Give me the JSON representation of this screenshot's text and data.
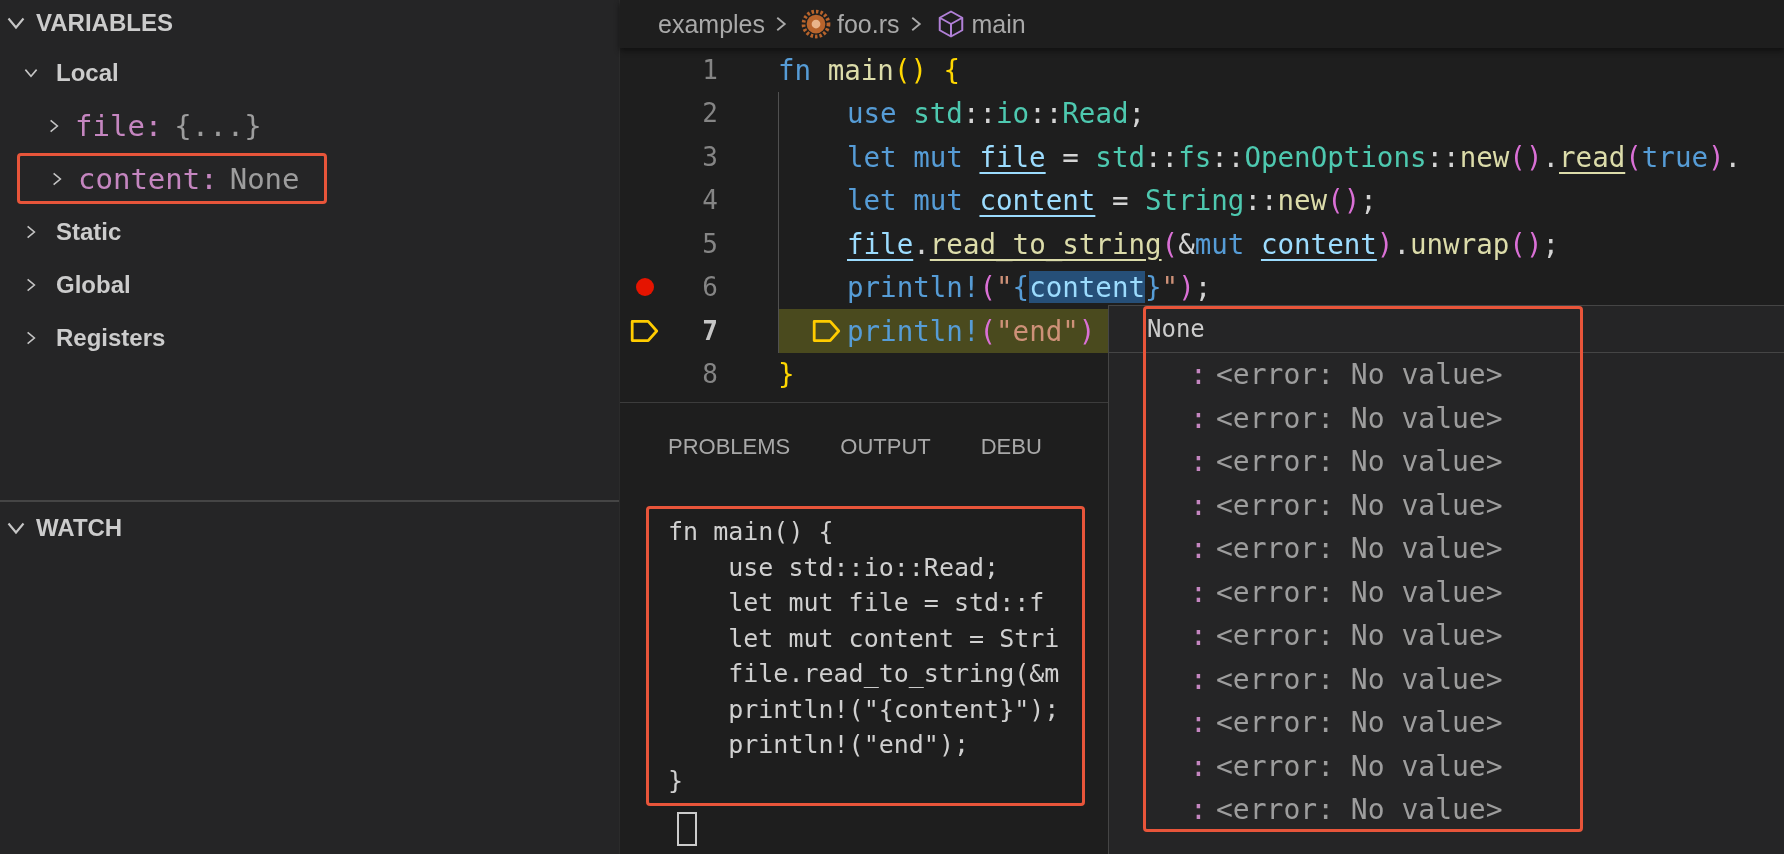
{
  "variables": {
    "title": "VARIABLES",
    "expanded": true,
    "scopes": [
      {
        "label": "Local",
        "expanded": true,
        "children": [
          {
            "name": "file:",
            "value": "{...}",
            "expanded": false,
            "highlighted": false
          },
          {
            "name": "content:",
            "value": "None",
            "expanded": false,
            "highlighted": true
          }
        ]
      },
      {
        "label": "Static",
        "expanded": false
      },
      {
        "label": "Global",
        "expanded": false
      },
      {
        "label": "Registers",
        "expanded": false
      }
    ]
  },
  "watch": {
    "title": "WATCH",
    "expanded": true
  },
  "breadcrumb": [
    {
      "label": "examples",
      "kind": "folder"
    },
    {
      "label": "foo.rs",
      "kind": "file"
    },
    {
      "label": "main",
      "kind": "symbol"
    }
  ],
  "code": [
    {
      "number": "1",
      "indented": false,
      "breakpoint": false,
      "current": false,
      "tokens": [
        {
          "text": "fn ",
          "kind": "keyword"
        },
        {
          "text": "main",
          "kind": "function"
        },
        {
          "text": "() {",
          "kind": "bracket1"
        }
      ]
    },
    {
      "number": "2",
      "indented": true,
      "breakpoint": false,
      "current": false,
      "tokens": [
        {
          "text": "use ",
          "kind": "keyword"
        },
        {
          "text": "std",
          "kind": "type"
        },
        {
          "text": "::",
          "kind": "punct"
        },
        {
          "text": "io",
          "kind": "type"
        },
        {
          "text": "::",
          "kind": "punct"
        },
        {
          "text": "Read",
          "kind": "type"
        },
        {
          "text": ";",
          "kind": "punct"
        }
      ]
    },
    {
      "number": "3",
      "indented": true,
      "breakpoint": false,
      "current": false,
      "tokens": [
        {
          "text": "let mut ",
          "kind": "keyword"
        },
        {
          "text": "file",
          "kind": "mutable"
        },
        {
          "text": " = ",
          "kind": "punct"
        },
        {
          "text": "std",
          "kind": "type"
        },
        {
          "text": "::",
          "kind": "punct"
        },
        {
          "text": "fs",
          "kind": "type"
        },
        {
          "text": "::",
          "kind": "punct"
        },
        {
          "text": "OpenOptions",
          "kind": "type"
        },
        {
          "text": "::",
          "kind": "punct"
        },
        {
          "text": "new",
          "kind": "function"
        },
        {
          "text": "()",
          "kind": "bracket2"
        },
        {
          "text": ".",
          "kind": "punct"
        },
        {
          "text": "read",
          "kind": "function-mut"
        },
        {
          "text": "(",
          "kind": "bracket2"
        },
        {
          "text": "true",
          "kind": "keyword"
        },
        {
          "text": ")",
          "kind": "bracket2"
        },
        {
          "text": ".",
          "kind": "punct"
        }
      ]
    },
    {
      "number": "4",
      "indented": true,
      "breakpoint": false,
      "current": false,
      "tokens": [
        {
          "text": "let mut ",
          "kind": "keyword"
        },
        {
          "text": "content",
          "kind": "mutable"
        },
        {
          "text": " = ",
          "kind": "punct"
        },
        {
          "text": "String",
          "kind": "type"
        },
        {
          "text": "::",
          "kind": "punct"
        },
        {
          "text": "new",
          "kind": "function"
        },
        {
          "text": "()",
          "kind": "bracket2"
        },
        {
          "text": ";",
          "kind": "punct"
        }
      ]
    },
    {
      "number": "5",
      "indented": true,
      "breakpoint": false,
      "current": false,
      "tokens": [
        {
          "text": "file",
          "kind": "mutable"
        },
        {
          "text": ".",
          "kind": "punct"
        },
        {
          "text": "read_to_string",
          "kind": "function-mut"
        },
        {
          "text": "(",
          "kind": "bracket2"
        },
        {
          "text": "&",
          "kind": "punct"
        },
        {
          "text": "mut ",
          "kind": "keyword"
        },
        {
          "text": "content",
          "kind": "mutable"
        },
        {
          "text": ")",
          "kind": "bracket2"
        },
        {
          "text": ".",
          "kind": "punct"
        },
        {
          "text": "unwrap",
          "kind": "function"
        },
        {
          "text": "()",
          "kind": "bracket2"
        },
        {
          "text": ";",
          "kind": "punct"
        }
      ]
    },
    {
      "number": "6",
      "indented": true,
      "breakpoint": true,
      "current": false,
      "tokens": [
        {
          "text": "println!",
          "kind": "macro"
        },
        {
          "text": "(",
          "kind": "bracket2"
        },
        {
          "text": "\"",
          "kind": "string"
        },
        {
          "text": "{",
          "kind": "interp-brace"
        },
        {
          "text": "content",
          "kind": "interp-hover"
        },
        {
          "text": "}",
          "kind": "interp-brace"
        },
        {
          "text": "\"",
          "kind": "string"
        },
        {
          "text": ")",
          "kind": "bracket2"
        },
        {
          "text": ";",
          "kind": "punct"
        }
      ]
    },
    {
      "number": "7",
      "indented": true,
      "breakpoint": false,
      "current": true,
      "tokens": [
        {
          "text": "println!",
          "kind": "macro"
        },
        {
          "text": "(",
          "kind": "bracket2"
        },
        {
          "text": "\"end\"",
          "kind": "string"
        },
        {
          "text": ")",
          "kind": "bracket2"
        }
      ]
    },
    {
      "number": "8",
      "indented": false,
      "breakpoint": false,
      "current": false,
      "tokens": [
        {
          "text": "}",
          "kind": "bracket1"
        }
      ]
    }
  ],
  "panel_tabs": [
    {
      "label": "PROBLEMS"
    },
    {
      "label": "OUTPUT"
    },
    {
      "label": "DEBU"
    }
  ],
  "terminal": {
    "highlighted": true,
    "cursor": true,
    "lines": [
      "fn main() {",
      "    use std::io::Read;",
      "    let mut file = std::f",
      "    let mut content = Stri",
      "    file.read_to_string(&m",
      "    println!(\"{content}\");",
      "    println!(\"end\");",
      "}"
    ]
  },
  "hover": {
    "title": "None",
    "highlighted": true,
    "rows": [
      {
        "key": ":",
        "value": "<error: No value>"
      },
      {
        "key": ":",
        "value": "<error: No value>"
      },
      {
        "key": ":",
        "value": "<error: No value>"
      },
      {
        "key": ":",
        "value": "<error: No value>"
      },
      {
        "key": ":",
        "value": "<error: No value>"
      },
      {
        "key": ":",
        "value": "<error: No value>"
      },
      {
        "key": ":",
        "value": "<error: No value>"
      },
      {
        "key": ":",
        "value": "<error: No value>"
      },
      {
        "key": ":",
        "value": "<error: No value>"
      },
      {
        "key": ":",
        "value": "<error: No value>"
      },
      {
        "key": ":",
        "value": "<error: No value>"
      }
    ]
  }
}
